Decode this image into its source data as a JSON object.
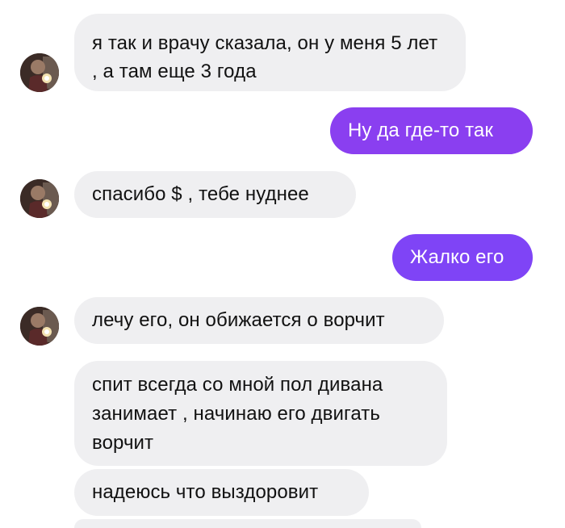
{
  "colors": {
    "incoming_bubble": "#efeff1",
    "outgoing_bubble_1": "#8a3ff0",
    "outgoing_bubble_2": "#7f44f6",
    "incoming_text": "#111111",
    "outgoing_text": "#ffffff"
  },
  "messages": [
    {
      "direction": "incoming",
      "text": "я так и врачу сказала, он у меня 5 лет , а там еще 3 года"
    },
    {
      "direction": "outgoing",
      "text": "Ну да где-то так"
    },
    {
      "direction": "incoming",
      "text": "спасибо $ , тебе нуднее"
    },
    {
      "direction": "outgoing",
      "text": "Жалко его"
    },
    {
      "direction": "incoming",
      "text": "лечу его, он обижается о ворчит"
    },
    {
      "direction": "incoming",
      "text": "спит всегда со мной пол дивана занимает , начинаю его двигать ворчит"
    },
    {
      "direction": "incoming",
      "text": "надеюсь что выздоровит"
    },
    {
      "direction": "incoming",
      "text": ""
    }
  ],
  "avatar_icon": "contact-avatar-photo"
}
